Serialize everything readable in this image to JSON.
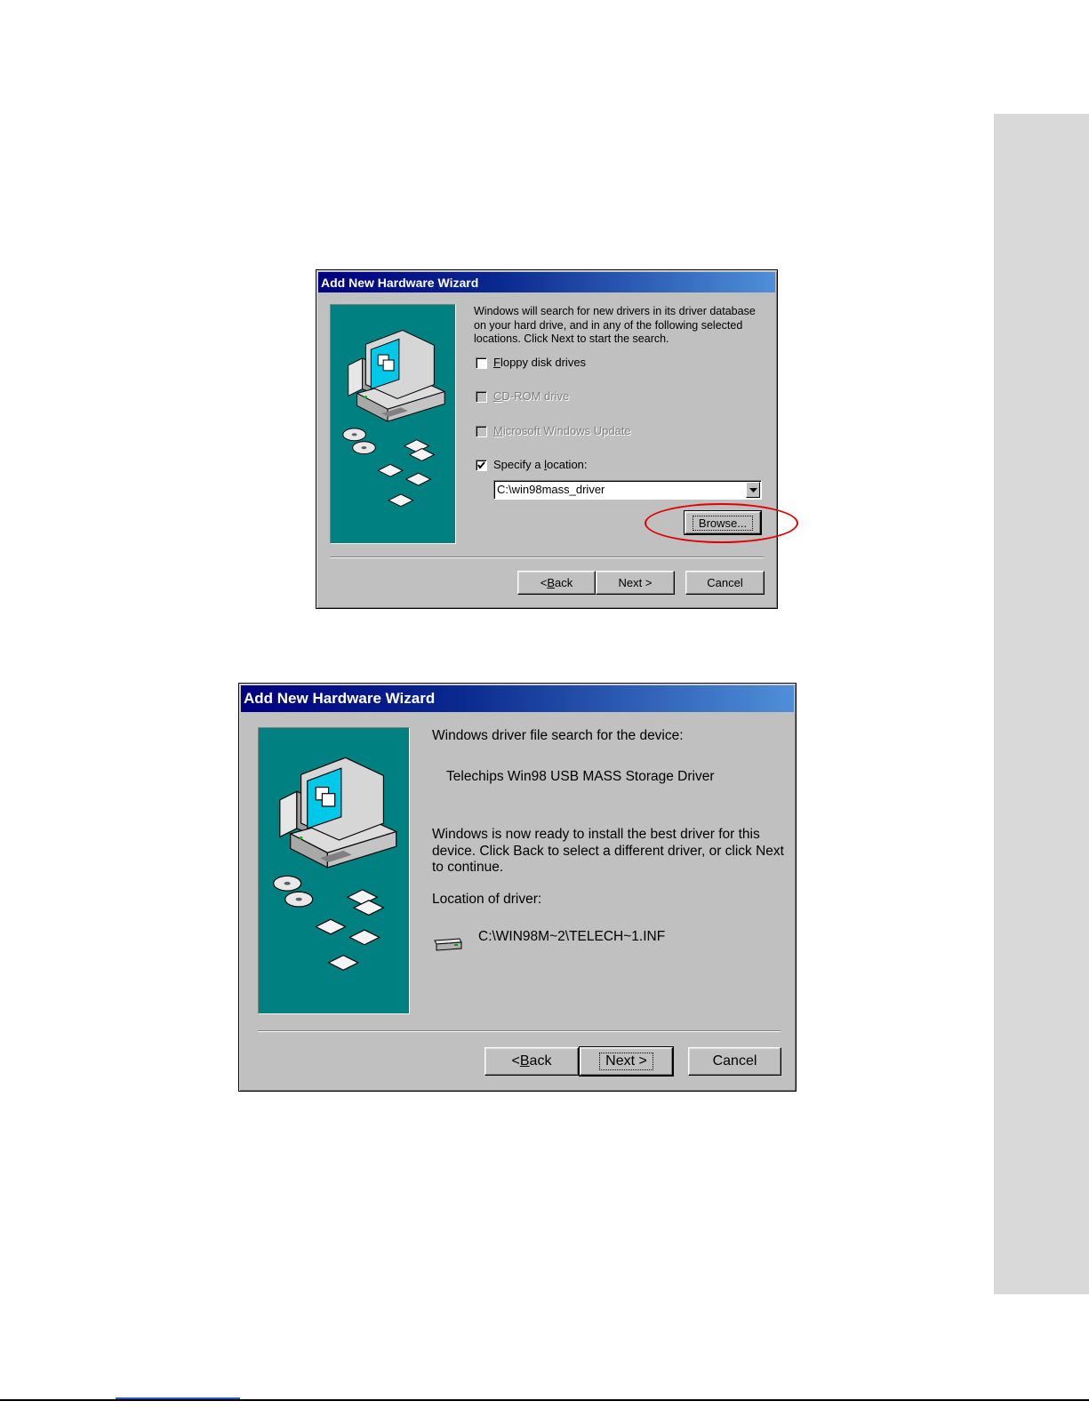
{
  "dialog1": {
    "title": "Add New Hardware Wizard",
    "intro": "Windows will search for new drivers in its driver database on your hard drive, and in any of the following selected locations. Click Next to start the search.",
    "options": [
      {
        "pre": "",
        "key": "F",
        "post": "loppy disk drives",
        "checked": false,
        "enabled": true
      },
      {
        "pre": "",
        "key": "C",
        "post": "D-ROM drive",
        "checked": false,
        "enabled": false
      },
      {
        "pre": "",
        "key": "M",
        "post": "icrosoft Windows Update",
        "checked": false,
        "enabled": false
      },
      {
        "pre": "Specify a ",
        "key": "l",
        "post": "ocation:",
        "checked": true,
        "enabled": true
      }
    ],
    "location_value": "C:\\win98mass_driver",
    "browse_label": "Browse...",
    "back": {
      "pre": "< ",
      "key": "B",
      "post": "ack"
    },
    "next_label": "Next >",
    "cancel_label": "Cancel"
  },
  "dialog2": {
    "title": "Add New Hardware Wizard",
    "search_heading": "Windows driver file search for the device:",
    "device_name": "Telechips Win98 USB MASS Storage Driver",
    "ready_text": "Windows is now ready to install the best driver for this device. Click Back to select a different driver, or click Next to continue.",
    "location_heading": "Location of driver:",
    "driver_path": "C:\\WIN98M~2\\TELECH~1.INF",
    "back": {
      "pre": "< ",
      "key": "B",
      "post": "ack"
    },
    "next_label": "Next >",
    "cancel_label": "Cancel"
  },
  "colors": {
    "art_teal": "#008080",
    "highlight": "#e00000",
    "title_start": "#000080",
    "title_end": "#4f8fd8"
  },
  "icons": [
    "computer-icon",
    "cd-icon",
    "floppy-icon",
    "drive-icon",
    "checkmark-icon",
    "dropdown-arrow-icon"
  ]
}
